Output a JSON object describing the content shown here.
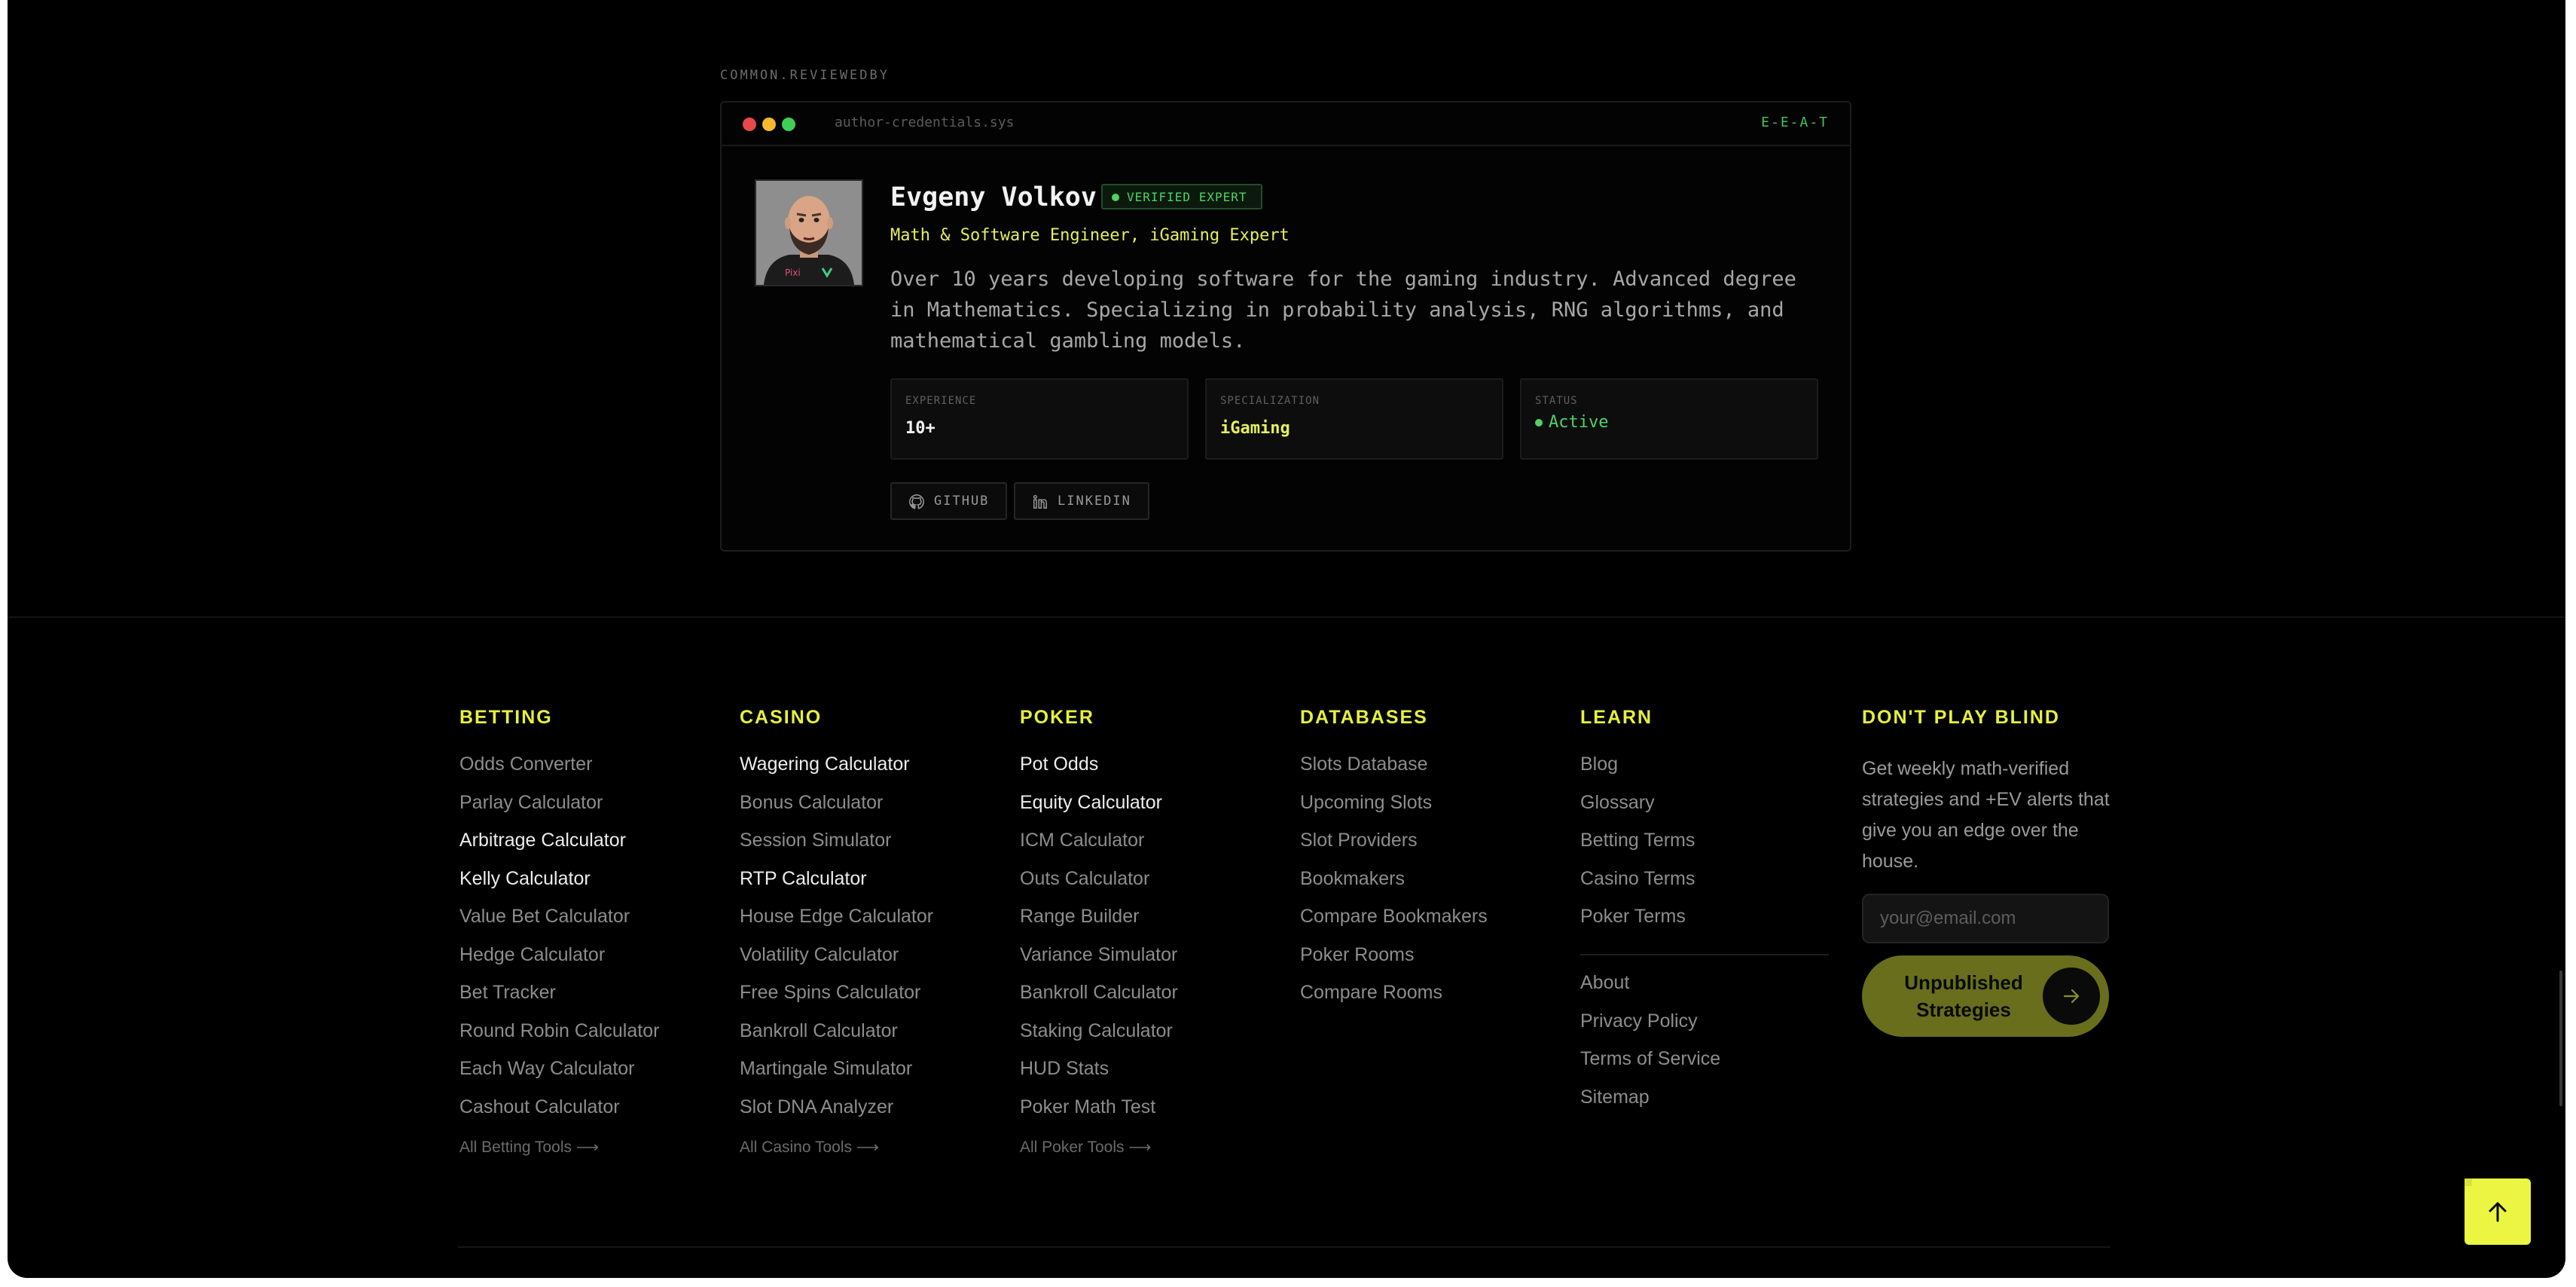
{
  "reviewer": {
    "section_label": "COMMON.REVIEWEDBY",
    "file_name": "author-credentials.sys",
    "eeat_tag": "E-E-A-T",
    "name": "Evgeny Volkov",
    "badge": "VERIFIED EXPERT",
    "role": "Math & Software Engineer, iGaming Expert",
    "bio": "Over 10 years developing software for the gaming industry. Advanced degree in Mathematics. Specializing in probability analysis, RNG algorithms, and mathematical gambling models.",
    "stats": [
      {
        "label": "EXPERIENCE",
        "value": "10+"
      },
      {
        "label": "SPECIALIZATION",
        "value": "iGaming"
      },
      {
        "label": "STATUS",
        "value": "Active"
      }
    ],
    "links": [
      {
        "label": "GITHUB",
        "icon": "github-icon"
      },
      {
        "label": "LINKEDIN",
        "icon": "linkedin-icon"
      }
    ],
    "avatar_shirt_text": "Pixi"
  },
  "footer": {
    "columns": [
      {
        "title": "BETTING",
        "items": [
          "Odds Converter",
          "Parlay Calculator",
          "Arbitrage Calculator",
          "Kelly Calculator",
          "Value Bet Calculator",
          "Hedge Calculator",
          "Bet Tracker",
          "Round Robin Calculator",
          "Each Way Calculator",
          "Cashout Calculator"
        ],
        "highlighted": [
          2,
          3
        ],
        "more": "All Betting Tools ⟶"
      },
      {
        "title": "CASINO",
        "items": [
          "Wagering Calculator",
          "Bonus Calculator",
          "Session Simulator",
          "RTP Calculator",
          "House Edge Calculator",
          "Volatility Calculator",
          "Free Spins Calculator",
          "Bankroll Calculator",
          "Martingale Simulator",
          "Slot DNA Analyzer"
        ],
        "highlighted": [
          0,
          3
        ],
        "more": "All Casino Tools ⟶"
      },
      {
        "title": "POKER",
        "items": [
          "Pot Odds",
          "Equity Calculator",
          "ICM Calculator",
          "Outs Calculator",
          "Range Builder",
          "Variance Simulator",
          "Bankroll Calculator",
          "Staking Calculator",
          "HUD Stats",
          "Poker Math Test"
        ],
        "highlighted": [
          0,
          1
        ],
        "more": "All Poker Tools ⟶"
      },
      {
        "title": "DATABASES",
        "items": [
          "Slots Database",
          "Upcoming Slots",
          "Slot Providers",
          "Bookmakers",
          "Compare Bookmakers",
          "Poker Rooms",
          "Compare Rooms"
        ],
        "highlighted": []
      },
      {
        "title": "LEARN",
        "items": [
          "Blog",
          "Glossary",
          "Betting Terms",
          "Casino Terms",
          "Poker Terms"
        ],
        "secondary": [
          "About",
          "Privacy Policy",
          "Terms of Service",
          "Sitemap"
        ],
        "highlighted": []
      }
    ],
    "newsletter": {
      "title": "DON'T PLAY BLIND",
      "text": "Get weekly math-verified strategies and +EV alerts that give you an edge over the house.",
      "placeholder": "your@email.com",
      "button_label": "Unpublished Strategies"
    }
  },
  "colors": {
    "accent_yellow": "#e6f03c",
    "verified_green": "#4fd266",
    "background": "#000000"
  }
}
